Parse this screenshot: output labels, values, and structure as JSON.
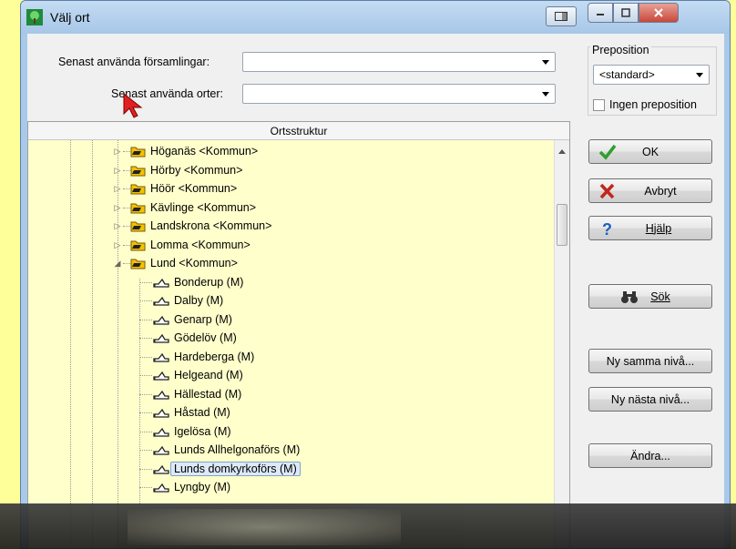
{
  "window": {
    "title": "Välj ort"
  },
  "top": {
    "recent_parishes_label": "Senast använda församlingar:",
    "recent_places_label": "Senast använda orter:",
    "recent_parishes_value": "",
    "recent_places_value": ""
  },
  "preposition": {
    "group_label": "Preposition",
    "selected": "<standard>",
    "no_preposition_label": "Ingen preposition"
  },
  "tree": {
    "header": "Ortsstruktur",
    "kommuner": [
      "Höganäs <Kommun>",
      "Hörby <Kommun>",
      "Höör <Kommun>",
      "Kävlinge <Kommun>",
      "Landskrona <Kommun>",
      "Lomma <Kommun>",
      "Lund <Kommun>"
    ],
    "lund_children": [
      "Bonderup (M)",
      "Dalby (M)",
      "Genarp (M)",
      "Gödelöv (M)",
      "Hardeberga (M)",
      "Helgeand (M)",
      "Hällestad (M)",
      "Håstad (M)",
      "Igelösa (M)",
      "Lunds Allhelgonaförs (M)",
      "Lunds domkyrkoförs (M)",
      "Lyngby (M)"
    ],
    "selected_item": "Lunds domkyrkoförs (M)"
  },
  "buttons": {
    "ok": "OK",
    "cancel": "Avbryt",
    "help": "Hjälp",
    "search": "Sök",
    "new_same_level": "Ny samma nivå...",
    "new_next_level": "Ny nästa nivå...",
    "change": "Ändra..."
  },
  "colors": {
    "tree_background": "#ffffcc",
    "page_background": "#ffff99",
    "ok_icon": "#2e9e2e",
    "cancel_icon": "#c0271f",
    "help_icon": "#1f5fbf",
    "cursor": "#e02020"
  }
}
